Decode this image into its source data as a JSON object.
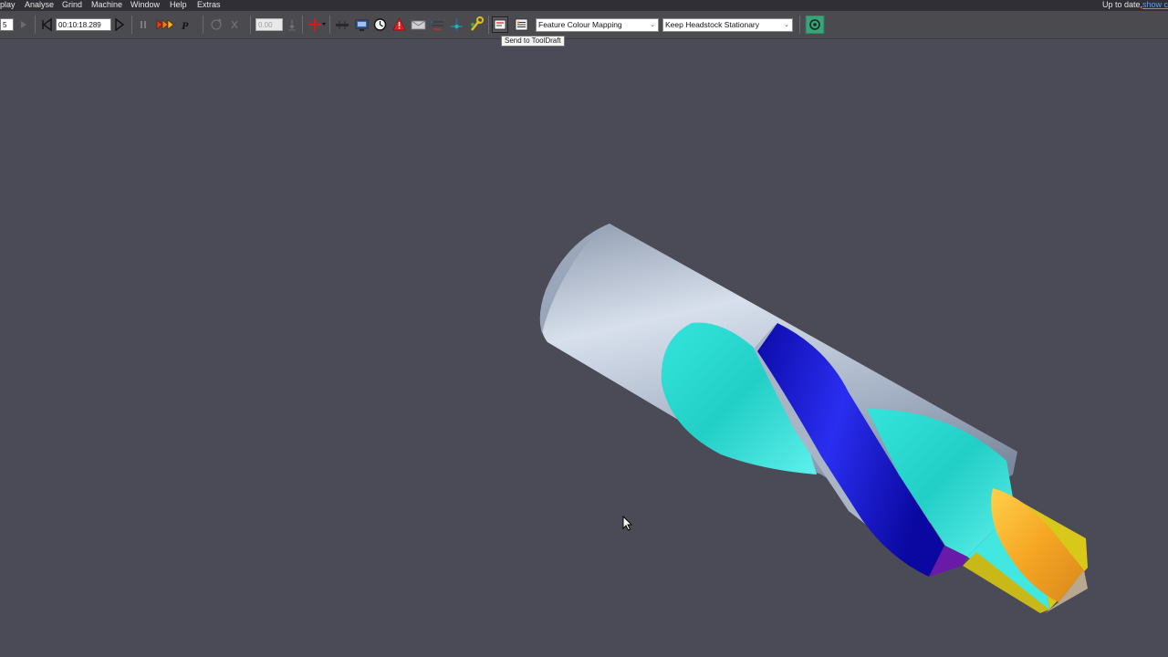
{
  "menu": {
    "items": [
      "play",
      "Analyse",
      "Grind",
      "Machine",
      "Window",
      "Help",
      "Extras"
    ],
    "status": "Up to date,",
    "link": "show c"
  },
  "toolbar": {
    "first_field": "5",
    "time_value": "00:10:18.289",
    "speed_value": "0.00",
    "feature_mapping": "Feature Colour Mapping",
    "headstock_mode": "Keep Headstock Stationary",
    "tooltip": "Send to ToolDraft",
    "icons": [
      "step-back-icon",
      "play-icon",
      "pause-icon",
      "fast-forward-icon",
      "p-icon",
      "reset-icon",
      "close-icon",
      "down-arrow-icon",
      "crosshair-icon",
      "ruler-icon",
      "display-icon",
      "clock-icon",
      "warning-icon",
      "envelope-icon",
      "align-icon",
      "axis-icon",
      "wrench-icon",
      "send-to-tooldraft-icon",
      "list-icon",
      "record-icon"
    ]
  },
  "colors": {
    "background": "#4b4a57",
    "shank": "#a9b6c9",
    "flute_cyan": "#2ee0d8",
    "flute_blue": "#1a18d8",
    "point_orange": "#f5a623",
    "point_yellow": "#d8c81a",
    "accent_green": "#3aa37a"
  }
}
